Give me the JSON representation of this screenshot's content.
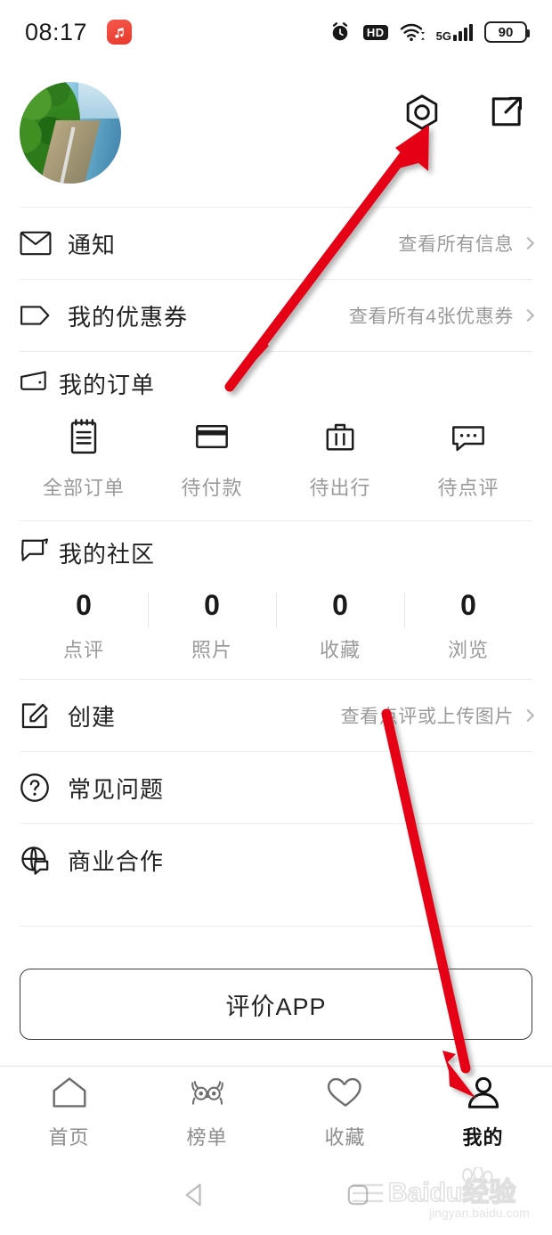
{
  "status_bar": {
    "time": "08:17",
    "app_icon": "music-note-icon",
    "alarm_icon": "alarm-clock-icon",
    "hd_label": "HD",
    "wifi_icon": "wifi-icon",
    "network_label": "5G",
    "battery_level": "90"
  },
  "profile": {
    "avatar_alt": "user-avatar-river-photo",
    "settings_icon": "settings-hexagon-icon",
    "share_icon": "share-external-icon"
  },
  "rows": {
    "notifications": {
      "icon": "envelope-icon",
      "label": "通知",
      "action": "查看所有信息"
    },
    "coupons": {
      "icon": "coupon-tag-icon",
      "label": "我的优惠券",
      "action": "查看所有4张优惠券"
    },
    "create": {
      "icon": "edit-square-icon",
      "label": "创建",
      "action": "查看点评或上传图片"
    },
    "faq": {
      "icon": "question-circle-icon",
      "label": "常见问题"
    },
    "business": {
      "icon": "globe-chat-icon",
      "label": "商业合作"
    }
  },
  "orders": {
    "icon": "wallet-icon",
    "title": "我的订单",
    "items": [
      {
        "icon": "clipboard-icon",
        "label": "全部订单"
      },
      {
        "icon": "credit-card-icon",
        "label": "待付款"
      },
      {
        "icon": "briefcase-icon",
        "label": "待出行"
      },
      {
        "icon": "comment-dots-icon",
        "label": "待点评"
      }
    ]
  },
  "community": {
    "icon": "speech-bubble-icon",
    "title": "我的社区",
    "stats": [
      {
        "value": "0",
        "label": "点评"
      },
      {
        "value": "0",
        "label": "照片"
      },
      {
        "value": "0",
        "label": "收藏"
      },
      {
        "value": "0",
        "label": "浏览"
      }
    ]
  },
  "rate_button": {
    "label": "评价APP"
  },
  "tabbar": {
    "items": [
      {
        "icon": "home-icon",
        "label": "首页",
        "active": false
      },
      {
        "icon": "owl-ranking-icon",
        "label": "榜单",
        "active": false
      },
      {
        "icon": "heart-icon",
        "label": "收藏",
        "active": false
      },
      {
        "icon": "person-icon",
        "label": "我的",
        "active": true
      }
    ]
  },
  "android_nav": {
    "back_icon": "back-triangle-icon",
    "home_icon": "home-square-icon"
  },
  "watermark": {
    "brand": "Baidu经验",
    "url": "jingyan.baidu.com"
  },
  "annotations": {
    "accent_color": "#e60012",
    "arrow_1_target": "settings-hexagon-icon",
    "arrow_2_target": "tab-mine"
  }
}
